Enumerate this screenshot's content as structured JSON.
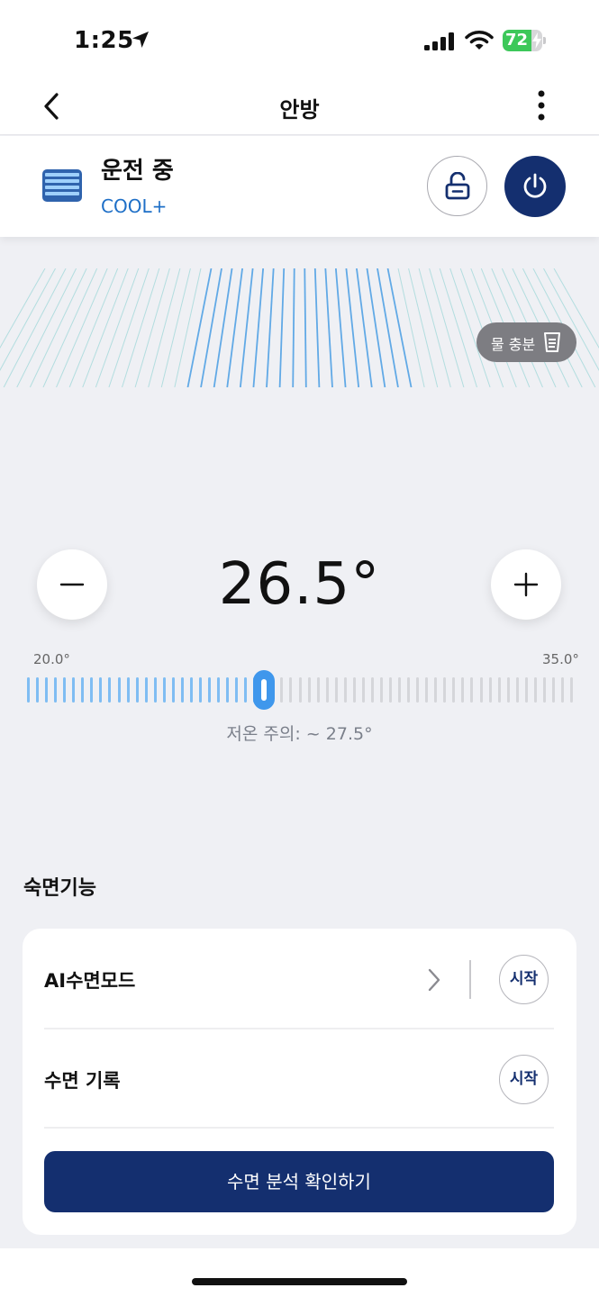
{
  "status_bar": {
    "time": "1:25",
    "battery_percent": "72",
    "battery_level": 0.72,
    "battery_color": "#3dc85a"
  },
  "nav": {
    "title": "안방",
    "back_icon": "chevron-left-icon",
    "more_icon": "vertical-ellipsis-icon"
  },
  "device": {
    "status": "운전 중",
    "mode": "COOL+",
    "mode_color": "#1e6fc7",
    "icon": "air-conditioner-icon",
    "lock_icon": "unlock-icon",
    "power_icon": "power-icon",
    "power_color": "#142f6f"
  },
  "water": {
    "label": "물 충분",
    "icon": "water-cup-icon"
  },
  "temperature": {
    "current": "26.5°",
    "current_value": 26.5,
    "min_label": "20.0°",
    "max_label": "35.0°",
    "min": 20.0,
    "max": 35.0,
    "low_temp_note": "저온 주의: ~ 27.5°",
    "active_color": "#7fbdf3",
    "inactive_color": "#d5d6da",
    "handle_color": "#3f97ec"
  },
  "sleep": {
    "section_title": "숙면기능",
    "ai_sleep_mode_label": "AI수면모드",
    "sleep_record_label": "수면 기록",
    "start_label_1": "시작",
    "start_label_2": "시작",
    "analysis_button_label": "수면 분석 확인하기",
    "accent_color": "#142f6f"
  }
}
